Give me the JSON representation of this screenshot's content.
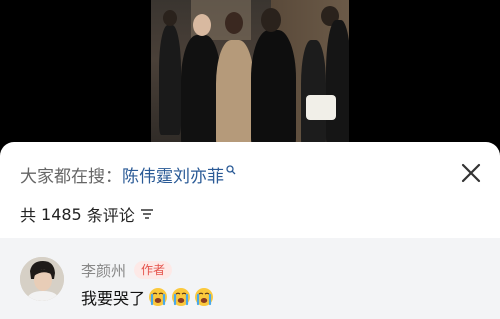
{
  "search_bar": {
    "prefix": "大家都在搜：",
    "term": "陈伟霆刘亦菲"
  },
  "comments_header": {
    "count_prefix": "共",
    "count": "1485",
    "count_suffix": "条评论"
  },
  "comment": {
    "author": "李颜州",
    "badge": "作者",
    "text": "我要哭了",
    "emoji_count": 3
  },
  "icons": {
    "search": "search-icon",
    "close": "close-icon",
    "filter": "filter-icon",
    "emoji": "crying-face-icon"
  },
  "colors": {
    "search_term": "#2a5a96",
    "badge_text": "#e4524b",
    "badge_bg": "#fde9e7"
  }
}
